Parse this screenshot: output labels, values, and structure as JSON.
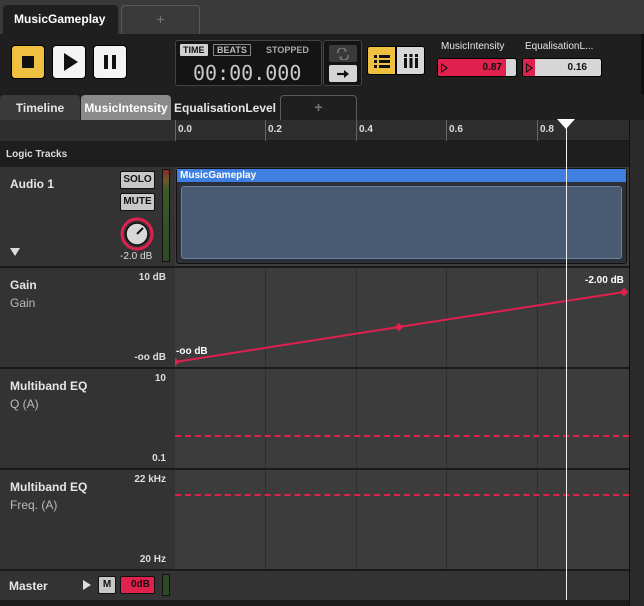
{
  "tabs": {
    "active": "MusicGameplay",
    "add": "+"
  },
  "transport": {
    "mode_time": "TIME",
    "mode_beats": "BEATS",
    "status": "STOPPED",
    "time": "00:00.000"
  },
  "params": [
    {
      "label": "MusicIntensity",
      "value": "0.87",
      "fill": 0.87
    },
    {
      "label": "EqualisationL...",
      "value": "0.16",
      "fill": 0.16
    }
  ],
  "subtabs": {
    "timeline": "Timeline",
    "music_intensity": "MusicIntensity",
    "equalisation": "EqualisationLevel",
    "add": "+"
  },
  "ruler": {
    "ticks": [
      "0.0",
      "0.2",
      "0.4",
      "0.6",
      "0.8"
    ]
  },
  "logic_tracks_label": "Logic Tracks",
  "audio_track": {
    "name": "Audio 1",
    "solo": "SOLO",
    "mute": "MUTE",
    "knob_value": "-2.0 dB",
    "region_label": "MusicGameplay"
  },
  "automation": [
    {
      "name": "Gain",
      "param": "Gain",
      "max": "10 dB",
      "min": "-oo dB",
      "start_label": "-oo dB",
      "end_label": "-2.00 dB"
    },
    {
      "name": "Multiband EQ",
      "param": "Q (A)",
      "max": "10",
      "min": "0.1"
    },
    {
      "name": "Multiband EQ",
      "param": "Freq. (A)",
      "max": "22 kHz",
      "min": "20 Hz"
    }
  ],
  "master": {
    "name": "Master",
    "m": "M",
    "fader": "0dB"
  },
  "colors": {
    "accent": "#f0c040",
    "automation": "#e0204d",
    "region": "#3e7fe0"
  }
}
